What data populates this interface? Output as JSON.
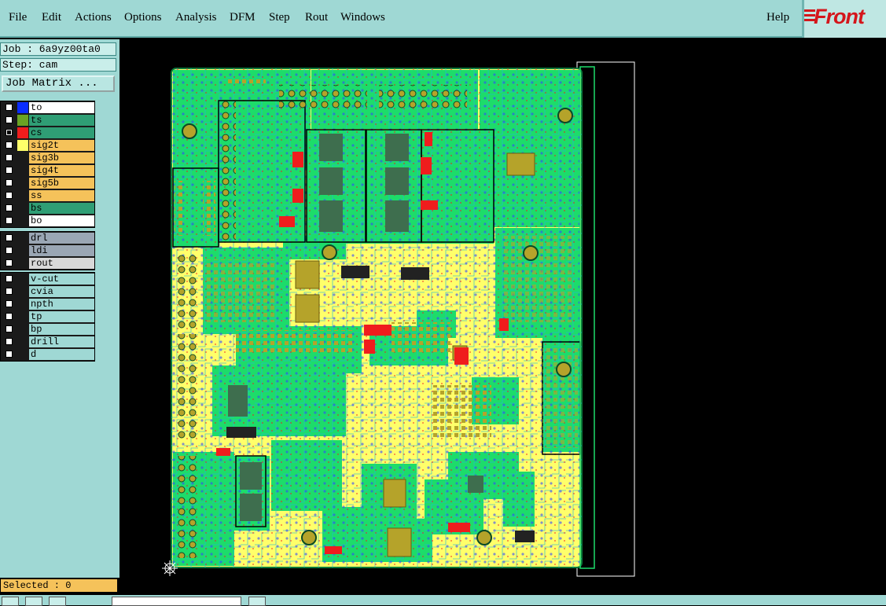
{
  "menubar": {
    "items": [
      "File",
      "Edit",
      "Actions",
      "Options",
      "Analysis",
      "DFM",
      "Step",
      "Rout",
      "Windows"
    ],
    "help": "Help",
    "logo": "Front"
  },
  "job": {
    "job_label": "Job : 6a9yz00ta0",
    "step_label": "Step: cam",
    "matrix_button": "Job Matrix ..."
  },
  "layers": {
    "group1": [
      {
        "name": "to",
        "color": "#ffffff",
        "swatch": "#0a2cff",
        "checked": false
      },
      {
        "name": "ts",
        "color": "#2f9e75",
        "swatch": "#6aa323",
        "checked": false
      },
      {
        "name": "cs",
        "color": "#2f9e75",
        "swatch": "#ef1d1d",
        "checked": true
      },
      {
        "name": "sig2t",
        "color": "#f5c25a",
        "swatch": "#ffff6a",
        "checked": false
      },
      {
        "name": "sig3b",
        "color": "#f5c25a",
        "swatch": "#1a1a1a",
        "checked": false
      },
      {
        "name": "sig4t",
        "color": "#f5c25a",
        "swatch": "#1a1a1a",
        "checked": false
      },
      {
        "name": "sig5b",
        "color": "#f5c25a",
        "swatch": "#1a1a1a",
        "checked": false
      },
      {
        "name": "ss",
        "color": "#f5c25a",
        "swatch": "#1a1a1a",
        "checked": false
      },
      {
        "name": "bs",
        "color": "#2f9e75",
        "swatch": "#1a1a1a",
        "checked": false
      },
      {
        "name": "bo",
        "color": "#ffffff",
        "swatch": "#1a1a1a",
        "checked": false
      }
    ],
    "group2": [
      {
        "name": "drl",
        "color": "#9aa6b4",
        "swatch": "#1a1a1a",
        "checked": false
      },
      {
        "name": "ldi",
        "color": "#9aa6b4",
        "swatch": "#1a1a1a",
        "checked": false
      },
      {
        "name": "rout",
        "color": "#d8d8d8",
        "swatch": "#1a1a1a",
        "checked": false
      }
    ],
    "group3": [
      {
        "name": "v-cut",
        "color": "#9fd8d4",
        "swatch": "#1a1a1a",
        "checked": false
      },
      {
        "name": "cvia",
        "color": "#9fd8d4",
        "swatch": "#1a1a1a",
        "checked": false
      },
      {
        "name": "npth",
        "color": "#9fd8d4",
        "swatch": "#1a1a1a",
        "checked": false
      },
      {
        "name": "tp",
        "color": "#9fd8d4",
        "swatch": "#1a1a1a",
        "checked": false
      },
      {
        "name": "bp",
        "color": "#9fd8d4",
        "swatch": "#1a1a1a",
        "checked": false
      },
      {
        "name": "drill",
        "color": "#9fd8d4",
        "swatch": "#1a1a1a",
        "checked": false
      },
      {
        "name": "d",
        "color": "#9fd8d4",
        "swatch": "#1a1a1a",
        "checked": false
      }
    ]
  },
  "status": {
    "selected": "Selected : 0"
  },
  "colors": {
    "panel": "#9fd8d4",
    "board_yellow": "#ffff6a",
    "board_green": "#1ddc6a",
    "copper": "#b5a32a",
    "red": "#ef1d1d"
  }
}
